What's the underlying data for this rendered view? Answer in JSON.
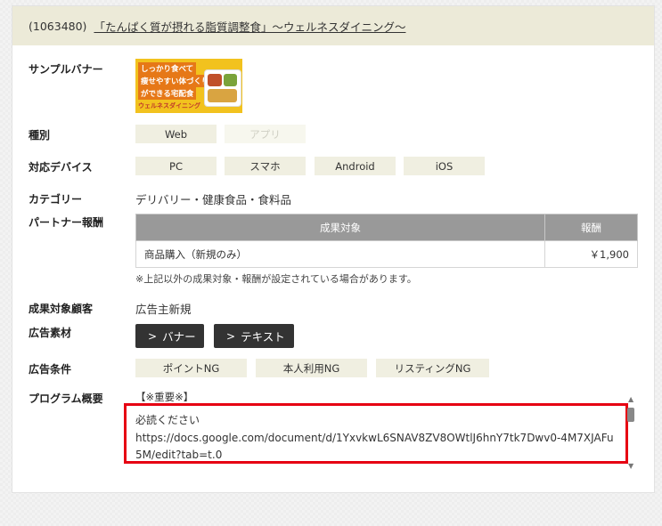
{
  "header": {
    "program_id": "(1063480)",
    "program_name": "「たんぱく質が摂れる脂質調整食」～ウェルネスダイニング～"
  },
  "banner": {
    "label": "サンプルバナー",
    "line1": "しっかり食べて",
    "line2": "痩せやすい体づくり",
    "line3": "ができる宅配食",
    "logo": "ウェルネスダイニング"
  },
  "type": {
    "label": "種別",
    "options": [
      "Web",
      "アプリ"
    ]
  },
  "devices": {
    "label": "対応デバイス",
    "items": [
      "PC",
      "スマホ",
      "Android",
      "iOS"
    ]
  },
  "category": {
    "label": "カテゴリー",
    "value": "デリバリー・健康食品・食料品"
  },
  "reward": {
    "label": "パートナー報酬",
    "col_target": "成果対象",
    "col_amount": "報酬",
    "rows": [
      {
        "target": "商品購入（新規のみ）",
        "amount": "￥1,900"
      }
    ],
    "note": "※上記以外の成果対象・報酬が設定されている場合があります。"
  },
  "customer": {
    "label": "成果対象顧客",
    "value": "広告主新規"
  },
  "materials": {
    "label": "広告素材",
    "banner_button": "バナー",
    "text_button": "テキスト"
  },
  "conditions": {
    "label": "広告条件",
    "items": [
      "ポイントNG",
      "本人利用NG",
      "リスティングNG"
    ]
  },
  "overview": {
    "label": "プログラム概要",
    "partial_top": "【※重要※】",
    "line1": "必読ください",
    "line2": "https://docs.google.com/document/d/1YxvkwL6SNAV8ZV8OWtlJ6hnY7tk7Dwv0-4M7XJAFu5M/edit?tab=t.0"
  },
  "colors": {
    "highlight_border": "#e60012",
    "header_bg": "#ecead8",
    "chip_bg": "#f0efe1",
    "button_bg": "#333333"
  }
}
